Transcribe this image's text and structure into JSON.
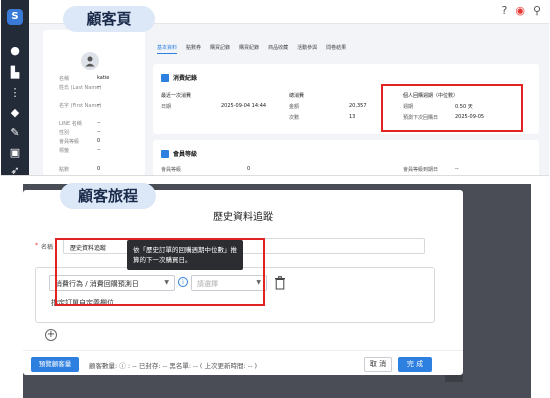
{
  "top": {
    "breadcrumb": "顧客",
    "profile": {
      "rows": [
        {
          "label": "名稱",
          "value": "katie"
        },
        {
          "label": "姓氏 (Last Name)",
          "value": "--"
        },
        {
          "label": "名字 (First Name)",
          "value": "--"
        },
        {
          "label": "LINE 名稱",
          "value": "--"
        },
        {
          "label": "性別",
          "value": "--"
        },
        {
          "label": "會員等級",
          "value": "0"
        },
        {
          "label": "標籤",
          "value": "--"
        }
      ],
      "footer_label": "點數",
      "footer_value": "0"
    },
    "tabs": [
      "基本資料",
      "點數券",
      "購買記錄",
      "購買紀錄",
      "商品收藏",
      "活動參與",
      "問卷結果"
    ],
    "purchase_card": {
      "title": "消費紀錄",
      "col1_head": "最近一次消費",
      "col1_label": "日期",
      "col1_value": "2025-09-04 14:44",
      "col2_head": "總消費",
      "col2_label1": "金額",
      "col2_value1": "20,357",
      "col2_label2": "次數",
      "col2_value2": "13",
      "col3_head": "個人回購週期（中位數）",
      "col3_label1": "週期",
      "col3_value1": "0.50 天",
      "col3_label2": "預測下次回購日",
      "col3_value2": "2025-09-05"
    },
    "member_card": {
      "title": "會員等級",
      "col1": "會員等級",
      "col1_value": "0",
      "col2": "會員等級到期日",
      "col2_value": "--"
    }
  },
  "labels": {
    "top_pill": "顧客頁",
    "bottom_pill": "顧客旅程"
  },
  "dialog": {
    "title": "歷史資料追蹤",
    "name_label": "名稱",
    "name_value": "歷史資料追蹤",
    "tooltip": "依「歷史訂單的回購週期中位數」推算的下一次購買日。",
    "select1": "消費行為 / 消費回購預測日",
    "select2_placeholder": "請選擇",
    "custom_field": "指定訂單自定義欄位",
    "footer_preview": "預覽顧客量",
    "footer_text": "顧客數量: ⓘ : --  已封存: --  黑名單: -- ( 上次更新時間: -- )",
    "cancel": "取 消",
    "done": "完 成"
  },
  "colors": {
    "accent": "#2d7fe0",
    "highlight": "#e02424",
    "pill_bg": "#dce8f7"
  }
}
